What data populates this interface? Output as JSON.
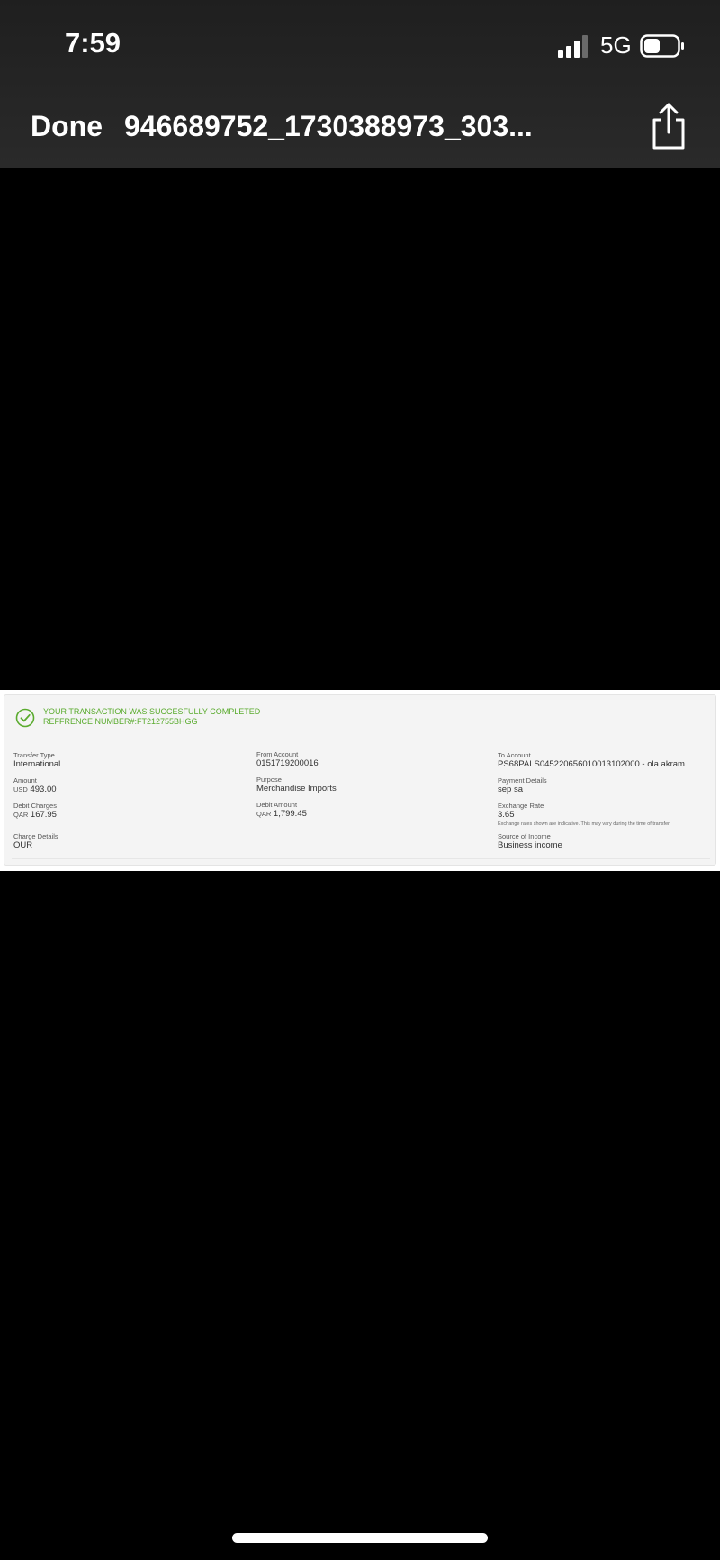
{
  "status_bar": {
    "time": "7:59",
    "network": "5G",
    "signal_bars": 3,
    "battery_level": 0.4
  },
  "viewer": {
    "done_label": "Done",
    "title": "946689752_1730388973_303...",
    "share_icon": "share-icon"
  },
  "transaction": {
    "status_line": "YOUR TRANSACTION WAS SUCCESFULLY COMPLETED",
    "reference_line": "REFFRENCE NUMBER#:FT212755BHGG",
    "accent_color": "#5aab2e",
    "fields": {
      "transfer_type": {
        "label": "Transfer Type",
        "value": "International"
      },
      "amount": {
        "label": "Amount",
        "currency": "USD",
        "value": "493.00"
      },
      "debit_charges": {
        "label": "Debit Charges",
        "currency": "QAR",
        "value": "167.95"
      },
      "charge_details": {
        "label": "Charge Details",
        "value": "OUR"
      },
      "from_account": {
        "label": "From Account",
        "value": "0151719200016"
      },
      "purpose": {
        "label": "Purpose",
        "value": "Merchandise Imports"
      },
      "debit_amount": {
        "label": "Debit Amount",
        "currency": "QAR",
        "value": "1,799.45"
      },
      "to_account": {
        "label": "To Account",
        "value": "PS68PALS045220656010013102000 - ola akram"
      },
      "payment_details": {
        "label": "Payment Details",
        "value": "sep sa"
      },
      "exchange_rate": {
        "label": "Exchange Rate",
        "value": "3.65",
        "note": "Exchange rates shown are indicative. This may vary during the time of transfer."
      },
      "source_of_income": {
        "label": "Source of Income",
        "value": "Business income"
      }
    }
  }
}
